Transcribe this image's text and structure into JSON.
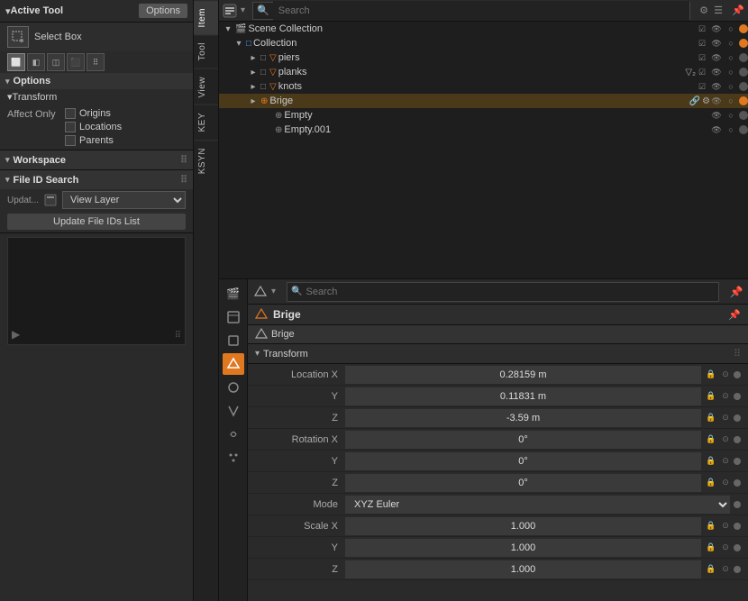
{
  "left": {
    "active_tool_label": "Active Tool",
    "options_btn": "Options",
    "select_box_label": "Select Box",
    "options_section_label": "Options",
    "transform_label": "Transform",
    "affect_only_label": "Affect Only",
    "origins_label": "Origins",
    "locations_label": "Locations",
    "parents_label": "Parents",
    "workspace_label": "Workspace",
    "workspace_dots": "⠿",
    "fileid_label": "File ID Search",
    "fileid_dots": "⠿",
    "view_layer_update_label": "Updat...",
    "view_layer_label": "View Layer",
    "update_btn_label": "Update File IDs List"
  },
  "vtabs": [
    "Item",
    "Tool",
    "View",
    "KEY",
    "KSYN"
  ],
  "outliner": {
    "scene_collection": "Scene Collection",
    "collection": "Collection",
    "items": [
      {
        "name": "piers",
        "depth": 2,
        "icon": "mesh",
        "has_children": false
      },
      {
        "name": "planks",
        "depth": 2,
        "icon": "mesh",
        "has_children": false,
        "badge": "▽₂"
      },
      {
        "name": "knots",
        "depth": 2,
        "icon": "mesh",
        "has_children": false
      },
      {
        "name": "Brige",
        "depth": 2,
        "icon": "empty",
        "has_children": false,
        "badges": [
          "🔗",
          "⚙"
        ]
      },
      {
        "name": "Empty",
        "depth": 3,
        "icon": "empty",
        "has_children": false
      },
      {
        "name": "Empty.001",
        "depth": 3,
        "icon": "empty",
        "has_children": false
      }
    ]
  },
  "properties": {
    "object_name": "Brige",
    "obj_header_name": "Brige",
    "transform_label": "Transform",
    "location_x": "0.28159 m",
    "location_y": "0.11831 m",
    "location_z": "-3.59 m",
    "rotation_x": "0°",
    "rotation_y": "0°",
    "rotation_z": "0°",
    "mode": "XYZ Euler",
    "scale_x": "1.000",
    "scale_y": "1.000",
    "scale_z": "1.000",
    "search_placeholder": "Search"
  },
  "icons": {
    "expand_open": "▾",
    "expand_closed": "▸",
    "scene": "🎬",
    "collection": "□",
    "mesh_tri": "▽",
    "empty": "⊕",
    "eye": "👁",
    "restrict": "○",
    "dot": "●"
  }
}
